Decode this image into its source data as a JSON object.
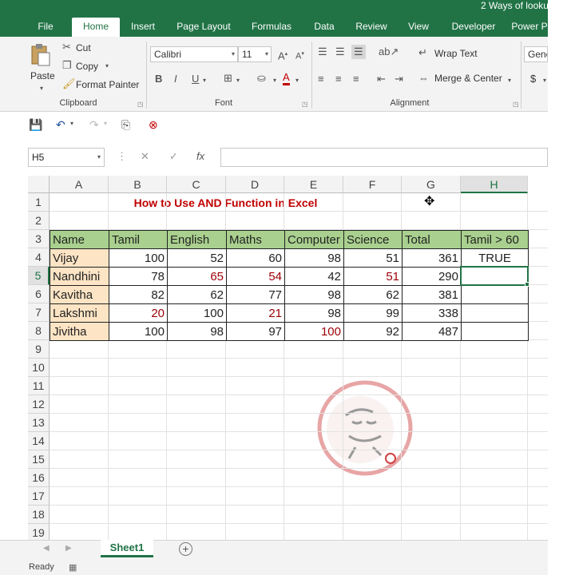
{
  "window": {
    "title": "2 Ways of looku"
  },
  "tabs": [
    "File",
    "Home",
    "Insert",
    "Page Layout",
    "Formulas",
    "Data",
    "Review",
    "View",
    "Developer",
    "Power P"
  ],
  "active_tab": "Home",
  "ribbon": {
    "clipboard": {
      "paste": "Paste",
      "cut": "Cut",
      "copy": "Copy",
      "format_painter": "Format Painter",
      "label": "Clipboard"
    },
    "font": {
      "name": "Calibri",
      "size": "11",
      "bold": "B",
      "italic": "I",
      "underline": "U",
      "label": "Font"
    },
    "alignment": {
      "wrap_text": "Wrap Text",
      "merge_center": "Merge & Center",
      "label": "Alignment"
    },
    "number": {
      "format": "Gene",
      "currency": "$"
    }
  },
  "formula_bar": {
    "name_box": "H5",
    "fx": "fx",
    "formula": ""
  },
  "sheet": {
    "columns": [
      "A",
      "B",
      "C",
      "D",
      "E",
      "F",
      "G",
      "H"
    ],
    "rows": [
      "1",
      "2",
      "3",
      "4",
      "5",
      "6",
      "7",
      "8",
      "9",
      "10",
      "11",
      "12",
      "13",
      "14",
      "15",
      "16",
      "17",
      "18",
      "19"
    ],
    "selected_column": "H",
    "selected_row": "5",
    "title": "How to Use AND Function in Excel",
    "headers": [
      "Name",
      "Tamil",
      "English",
      "Maths",
      "Computer",
      "Science",
      "Total",
      "Tamil > 60"
    ],
    "data": [
      [
        "Vijay",
        "100",
        "52",
        "60",
        "98",
        "51",
        "361",
        "TRUE"
      ],
      [
        "Nandhini",
        "78",
        "65",
        "54",
        "42",
        "51",
        "290",
        ""
      ],
      [
        "Kavitha",
        "82",
        "62",
        "77",
        "98",
        "62",
        "381",
        ""
      ],
      [
        "Lakshmi",
        "20",
        "100",
        "21",
        "98",
        "99",
        "338",
        ""
      ],
      [
        "Jivitha",
        "100",
        "98",
        "97",
        "100",
        "92",
        "487",
        ""
      ]
    ],
    "highlight_color": "#9c0006",
    "header_fill": "#a9d08e",
    "name_fill": "#fce4c4"
  },
  "sheet_tabs": [
    "Sheet1"
  ],
  "status": "Ready",
  "accent": "#217346"
}
